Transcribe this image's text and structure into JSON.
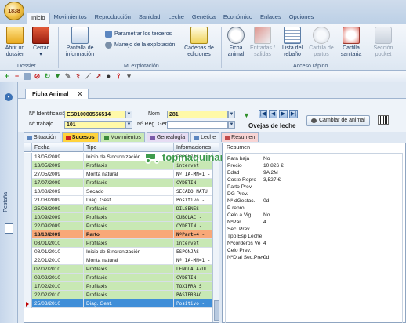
{
  "app": {
    "logo_text": "1838"
  },
  "menu_tabs": [
    "Inicio",
    "Movimientos",
    "Reproducción",
    "Sanidad",
    "Leche",
    "Genética",
    "Económico",
    "Enlaces",
    "Opciones"
  ],
  "ribbon": {
    "abrir": "Abrir un dossier",
    "cerrar": "Cerrar",
    "dossier_group": "Dossier",
    "pantalla": "Pantalla de información",
    "parametrar": "Parametrar los terceros",
    "manejo": "Manejo de la explotación",
    "cadenas": "Cadenas de ediciones",
    "mi_explotacion_group": "Mi explotación",
    "ficha": "Ficha animal",
    "entradas": "Entradas / salidas",
    "lista": "Lista del rebaño",
    "cartilla_partos": "Cartilla de partos",
    "cartilla_sanitaria": "Cartilla sanitaria",
    "seccion_pocket": "Sección pocket",
    "acceso_group": "Acceso rápido"
  },
  "rail": {
    "label": "Pestaña"
  },
  "doc_tab": {
    "title": "Ficha Animal",
    "close": "X"
  },
  "form": {
    "id_label": "Nº Identificación",
    "id_value": "ES010000556514",
    "trabajo_label": "Nº trabajo",
    "trabajo_value": "101",
    "nom_label": "Nom",
    "nom_value": "281",
    "reg_label": "Nº Reg. Gen",
    "reg_value": "",
    "especie": "Ovejas de leche",
    "cambiar": "Cambiar de animal"
  },
  "subtabs": [
    "Situación",
    "Sucesos",
    "Movimientos",
    "Genealogía",
    "Leche",
    "Resumen"
  ],
  "grid": {
    "columns": [
      "Fecha",
      "Tipo",
      "Informaciones"
    ],
    "rows": [
      {
        "fecha": "13/05/2009",
        "tipo": "Inicio de Sincronización",
        "info": "ESPONJAS",
        "style": ""
      },
      {
        "fecha": "13/05/2009",
        "tipo": "Profilaxis",
        "info": "intervet",
        "style": "green"
      },
      {
        "fecha": "27/05/2009",
        "tipo": "Monta natural",
        "info": "Nº IA-MN=1 -",
        "style": ""
      },
      {
        "fecha": "17/07/2009",
        "tipo": "Profilaxis",
        "info": "CYDETIN -",
        "style": "green"
      },
      {
        "fecha": "10/08/2009",
        "tipo": "Secado",
        "info": "SECADO NATU",
        "style": ""
      },
      {
        "fecha": "21/08/2009",
        "tipo": "Diag. Gest.",
        "info": "Positivo -",
        "style": ""
      },
      {
        "fecha": "25/08/2009",
        "tipo": "Profilaxis",
        "info": "DILSENES -",
        "style": "green"
      },
      {
        "fecha": "10/09/2009",
        "tipo": "Profilaxis",
        "info": "CUBOLAC -",
        "style": "green"
      },
      {
        "fecha": "22/09/2009",
        "tipo": "Profilaxis",
        "info": "CYDETIN -",
        "style": "green"
      },
      {
        "fecha": "18/10/2009",
        "tipo": "Parto",
        "info": "NºPart=4 -",
        "style": "orange"
      },
      {
        "fecha": "08/01/2010",
        "tipo": "Profilaxis",
        "info": "intervet",
        "style": "green"
      },
      {
        "fecha": "08/01/2010",
        "tipo": "Inicio de Sincronización",
        "info": "ESPONJAS",
        "style": ""
      },
      {
        "fecha": "22/01/2010",
        "tipo": "Monta natural",
        "info": "Nº IA-MN=1 -",
        "style": ""
      },
      {
        "fecha": "02/02/2010",
        "tipo": "Profilaxis",
        "info": "LENGUA AZUL",
        "style": "green"
      },
      {
        "fecha": "02/02/2010",
        "tipo": "Profilaxis",
        "info": "CYDETIN -",
        "style": "green"
      },
      {
        "fecha": "17/02/2010",
        "tipo": "Profilaxis",
        "info": "TOXIPRA S",
        "style": "green"
      },
      {
        "fecha": "22/02/2010",
        "tipo": "Profilaxis",
        "info": "PASTERBAC",
        "style": "green"
      },
      {
        "fecha": "25/03/2010",
        "tipo": "Diag. Gest.",
        "info": "Positivo -",
        "style": "blue"
      }
    ]
  },
  "resumen": {
    "title": "Resumen",
    "rows": [
      {
        "k": "Para baja",
        "v": "No"
      },
      {
        "k": "Precio",
        "v": "10,826 €"
      },
      {
        "k": "Edad",
        "v": "9A 2M"
      },
      {
        "k": "Coste Repro",
        "v": "3,527 €"
      },
      {
        "k": "Parto Prev.",
        "v": ""
      },
      {
        "k": "DG Prev.",
        "v": ""
      },
      {
        "k": "Nº dGestac.",
        "v": "0d"
      },
      {
        "k": "P repro",
        "v": ""
      },
      {
        "k": "Celo a Vig.",
        "v": "No"
      },
      {
        "k": "NºPar",
        "v": "4"
      },
      {
        "k": "Sec. Prev.",
        "v": ""
      },
      {
        "k": "Tpo Esp Leche",
        "v": ""
      },
      {
        "k": "Nºcorderos Ve",
        "v": "4"
      },
      {
        "k": "Celo Prev.",
        "v": ""
      },
      {
        "k": "NºD.al Sec.Prev",
        "v": "0d"
      }
    ]
  },
  "watermark": "topmaquinaria",
  "colors": {
    "yellow_field": "#fff9a8",
    "green_row": "#c8e8b4",
    "orange_row": "#f8a878",
    "blue_row": "#3f8ed8"
  }
}
